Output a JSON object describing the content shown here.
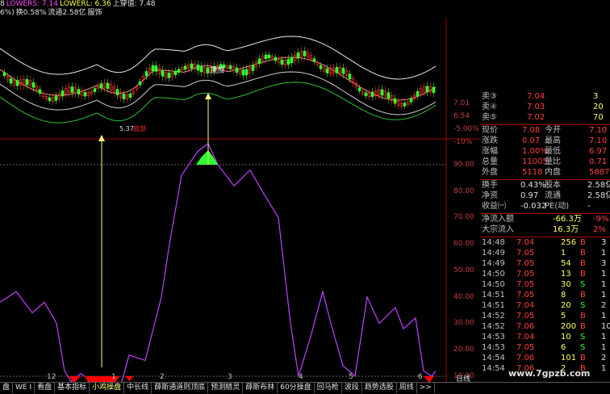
{
  "header": {
    "line1": [
      {
        "text": "8",
        "cls": "c-white"
      },
      {
        "text": "LOWERS: 7.14",
        "cls": "c-pink"
      },
      {
        "text": "LOWERL: 6.36",
        "cls": "c-yellow"
      },
      {
        "text": "上穿值: 7.48",
        "cls": "c-white"
      }
    ],
    "line2": [
      {
        "text": "6%)",
        "cls": "c-white"
      },
      {
        "text": "换0.58%",
        "cls": "c-white"
      },
      {
        "text": "流通2.58亿",
        "cls": "c-white"
      },
      {
        "text": "服饰",
        "cls": "c-white"
      }
    ]
  },
  "chart_labels": {
    "peak": "顶顶",
    "low": "5.37",
    "bottom_marker": "底部"
  },
  "price_axis": [
    "7.01",
    "6.54",
    "-5.00%",
    "-10%"
  ],
  "indicator_axis": [
    "90.00",
    "80.00",
    "70.00",
    "60.00",
    "50.00",
    "40.00",
    "30.00",
    "20.00",
    "10.00"
  ],
  "x_axis": [
    "12",
    "1",
    "2",
    "3",
    "4",
    "5",
    "6"
  ],
  "colors": {
    "up": "#ff3030",
    "down": "#30ff30",
    "indicator": "#c040ff",
    "signal": "#ff0000"
  },
  "quotes": {
    "asks": [
      {
        "label": "卖③",
        "price": "7.04",
        "vol": "3"
      },
      {
        "label": "卖④",
        "price": "7.03",
        "vol": "20"
      },
      {
        "label": "卖⑤",
        "price": "7.02",
        "vol": "70"
      }
    ],
    "stats": [
      {
        "l1": "现价",
        "v1": "7.08",
        "l2": "今开",
        "v2": "7.10"
      },
      {
        "l1": "涨跌",
        "v1": "0.07",
        "l2": "最高",
        "v2": "7.10"
      },
      {
        "l1": "涨幅",
        "v1": "1.00%",
        "l2": "最低",
        "v2": "6.97"
      },
      {
        "l1": "总量",
        "v1": "11005",
        "l2": "量比",
        "v2": "0.71"
      },
      {
        "l1": "外盘",
        "v1": "5118",
        "l2": "内盘",
        "v2": "5887"
      }
    ],
    "stats2": [
      {
        "l1": "换手",
        "v1": "0.43%",
        "l2": "股本",
        "v2": "2.58亿"
      },
      {
        "l1": "净资",
        "v1": "0.97",
        "l2": "流通",
        "v2": "2.58亿"
      },
      {
        "l1": "收益㈠",
        "v1": "-0.032",
        "l2": "PE(动)",
        "v2": "-"
      }
    ],
    "flows": [
      {
        "label": "净流入额",
        "v1": "-66.3万",
        "v2": "-9%"
      },
      {
        "label": "大宗流入",
        "v1": "16.3万",
        "v2": "2%"
      }
    ],
    "ticks": [
      {
        "t": "14:48",
        "p": "7.04",
        "v": "256",
        "bs": "B",
        "n": "3"
      },
      {
        "t": "14:49",
        "p": "7.05",
        "v": "1",
        "bs": "B",
        "n": "1"
      },
      {
        "t": "14:49",
        "p": "7.05",
        "v": "54",
        "bs": "B",
        "n": "3"
      },
      {
        "t": "14:50",
        "p": "7.05",
        "v": "13",
        "bs": "B",
        "n": "1"
      },
      {
        "t": "14:50",
        "p": "7.05",
        "v": "30",
        "bs": "S",
        "n": "1"
      },
      {
        "t": "14:51",
        "p": "7.05",
        "v": "8",
        "bs": "B",
        "n": "1"
      },
      {
        "t": "14:51",
        "p": "7.04",
        "v": "20",
        "bs": "S",
        "n": "2"
      },
      {
        "t": "14:52",
        "p": "7.05",
        "v": "5",
        "bs": "B",
        "n": "1"
      },
      {
        "t": "14:52",
        "p": "7.06",
        "v": "200",
        "bs": "B",
        "n": "10"
      },
      {
        "t": "14:53",
        "p": "7.04",
        "v": "10",
        "bs": "S",
        "n": "1"
      },
      {
        "t": "14:53",
        "p": "7.05",
        "v": "6",
        "bs": "S",
        "n": "1"
      },
      {
        "t": "14:54",
        "p": "7.06",
        "v": "101",
        "bs": "B",
        "n": "2"
      },
      {
        "t": "14:54",
        "p": "7.06",
        "v": "2",
        "bs": "B",
        "n": "1"
      }
    ]
  },
  "watermark": "www.7gpzb.com",
  "bottom_tabs": [
    {
      "label": "盘",
      "active": false
    },
    {
      "label": "WE I",
      "active": false
    },
    {
      "label": "看盘",
      "active": false
    },
    {
      "label": "基本指标",
      "active": false
    },
    {
      "label": "小鸡操盘",
      "active": true
    },
    {
      "label": "中长线",
      "active": false
    },
    {
      "label": "薛斯通道则顶底",
      "active": false
    },
    {
      "label": "预测精灵",
      "active": false
    },
    {
      "label": "薛斯布林",
      "active": false
    },
    {
      "label": "60分操盘",
      "active": false
    },
    {
      "label": "回马枪",
      "active": false
    },
    {
      "label": "波段",
      "active": false
    },
    {
      "label": "趋势选股",
      "active": false
    },
    {
      "label": "周线",
      "active": false
    },
    {
      "label": ">>",
      "active": false
    }
  ],
  "period_label": "日线"
}
